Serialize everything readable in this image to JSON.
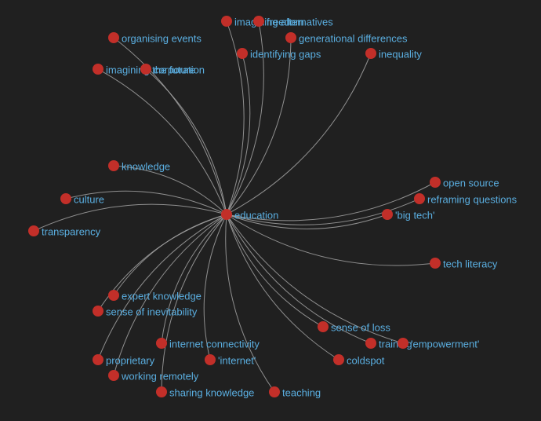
{
  "graph": {
    "title": "",
    "colors": {
      "background": "#202020",
      "node": "#c22f29",
      "label": "#5aaee0",
      "edge": "#a3a3a3"
    },
    "center": {
      "id": "education",
      "label": "education"
    },
    "nodes": [
      {
        "id": "imagining-alternatives",
        "label": "imagining alternatives"
      },
      {
        "id": "freedom",
        "label": "freedom"
      },
      {
        "id": "organising-events",
        "label": "organising events"
      },
      {
        "id": "generational-differences",
        "label": "generational differences"
      },
      {
        "id": "identifying-gaps",
        "label": "identifying gaps"
      },
      {
        "id": "inequality",
        "label": "inequality"
      },
      {
        "id": "imagining-the-future",
        "label": "imagining the future"
      },
      {
        "id": "corporation",
        "label": "corporation"
      },
      {
        "id": "knowledge",
        "label": "knowledge"
      },
      {
        "id": "culture",
        "label": "culture"
      },
      {
        "id": "transparency",
        "label": "transparency"
      },
      {
        "id": "open-source",
        "label": "open source"
      },
      {
        "id": "reframing-questions",
        "label": "reframing questions"
      },
      {
        "id": "big-tech",
        "label": "'big tech'"
      },
      {
        "id": "tech-literacy",
        "label": "tech literacy"
      },
      {
        "id": "expert-knowledge",
        "label": "expert knowledge"
      },
      {
        "id": "sense-of-inevitability",
        "label": "sense of inevitability"
      },
      {
        "id": "internet-connectivity",
        "label": "internet connectivity"
      },
      {
        "id": "proprietary",
        "label": "proprietary"
      },
      {
        "id": "internet",
        "label": "'internet'"
      },
      {
        "id": "working-remotely",
        "label": "working remotely"
      },
      {
        "id": "sharing-knowledge",
        "label": "sharing knowledge"
      },
      {
        "id": "teaching",
        "label": "teaching"
      },
      {
        "id": "sense-of-loss",
        "label": "sense of loss"
      },
      {
        "id": "training",
        "label": "training"
      },
      {
        "id": "empowerment",
        "label": "'empowerment'"
      },
      {
        "id": "coldspot",
        "label": "coldspot"
      }
    ],
    "edges_from_center_to": [
      "imagining-alternatives",
      "freedom",
      "organising-events",
      "generational-differences",
      "identifying-gaps",
      "inequality",
      "imagining-the-future",
      "corporation",
      "knowledge",
      "culture",
      "transparency",
      "open-source",
      "reframing-questions",
      "big-tech",
      "tech-literacy",
      "expert-knowledge",
      "sense-of-inevitability",
      "internet-connectivity",
      "proprietary",
      "internet",
      "working-remotely",
      "sharing-knowledge",
      "teaching",
      "sense-of-loss",
      "training",
      "empowerment",
      "coldspot"
    ]
  }
}
